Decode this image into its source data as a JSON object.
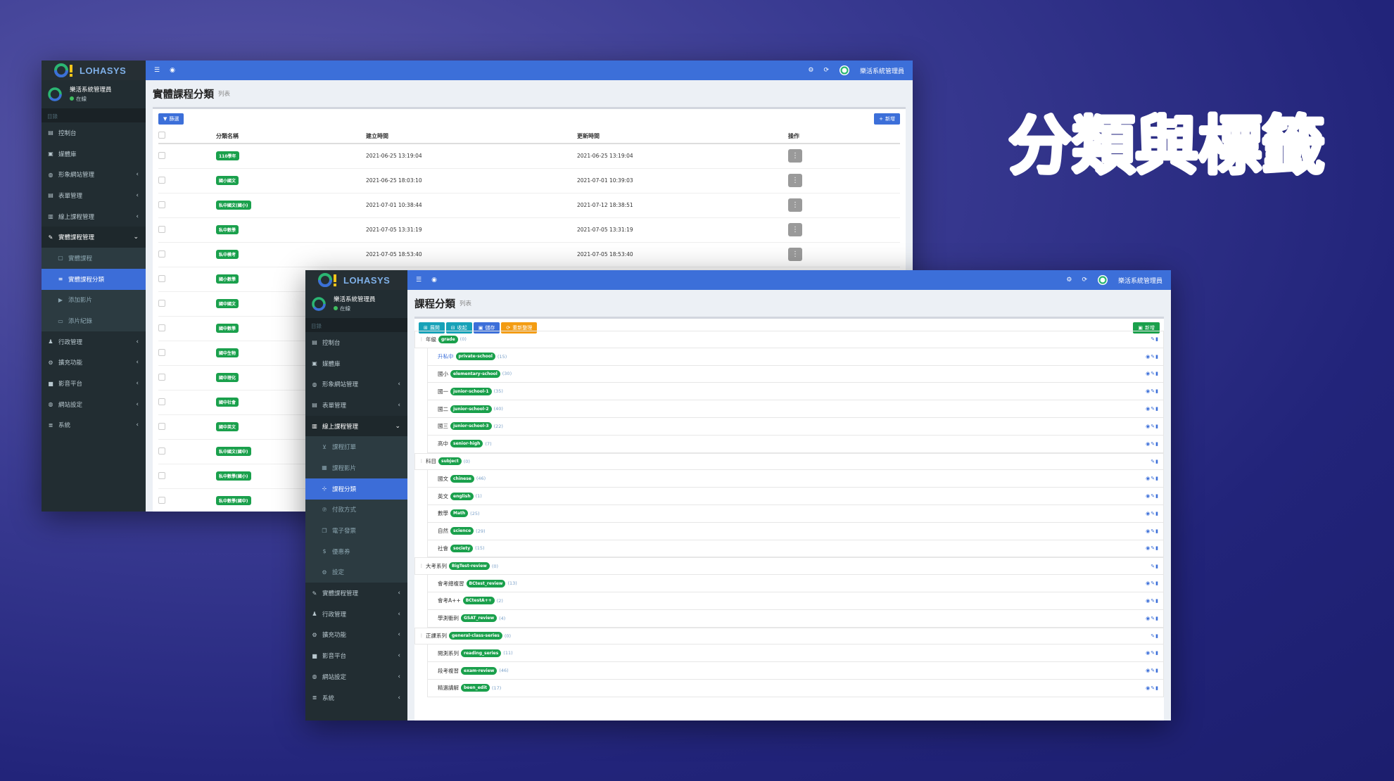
{
  "hero_title": "分類與標籤",
  "brand": "LOHASYS",
  "user": {
    "name": "樂活系統管理員",
    "status": "在線"
  },
  "sidebar_header": "目錄",
  "window1": {
    "menu": [
      {
        "label": "控制台",
        "icon": "chart-icon",
        "chev": ""
      },
      {
        "label": "媒體庫",
        "icon": "image-icon",
        "chev": ""
      },
      {
        "label": "形象網站管理",
        "icon": "globe-icon",
        "chev": "‹"
      },
      {
        "label": "表單管理",
        "icon": "form-icon",
        "chev": "‹"
      },
      {
        "label": "線上課程管理",
        "icon": "bank-icon",
        "chev": "‹"
      },
      {
        "label": "實體課程管理",
        "icon": "edit-icon",
        "chev": "⌄"
      },
      {
        "label": "實體課程",
        "icon": "square-icon",
        "chev": ""
      },
      {
        "label": "實體課程分類",
        "icon": "list-icon",
        "chev": ""
      },
      {
        "label": "添加影片",
        "icon": "video-icon",
        "chev": ""
      },
      {
        "label": "添片紀錄",
        "icon": "monitor-icon",
        "chev": ""
      },
      {
        "label": "行政管理",
        "icon": "user-icon",
        "chev": "‹"
      },
      {
        "label": "擴充功能",
        "icon": "gears-icon",
        "chev": "‹"
      },
      {
        "label": "影音平台",
        "icon": "camera-icon",
        "chev": "‹"
      },
      {
        "label": "網站設定",
        "icon": "globe-icon",
        "chev": "‹"
      },
      {
        "label": "系統",
        "icon": "menu-icon",
        "chev": "‹"
      }
    ],
    "page_title": "實體課程分類",
    "page_subtitle": "列表",
    "filter_btn": "篩選",
    "add_btn": "新增",
    "columns": [
      "分類名稱",
      "建立時間",
      "更新時間",
      "操作"
    ],
    "rows": [
      {
        "tag": "110學年",
        "created": "2021-06-25 13:19:04",
        "updated": "2021-06-25 13:19:04"
      },
      {
        "tag": "國小國文",
        "created": "2021-06-25 18:03:10",
        "updated": "2021-07-01 10:39:03"
      },
      {
        "tag": "私中國文(國小)",
        "created": "2021-07-01 10:38:44",
        "updated": "2021-07-12 18:38:51"
      },
      {
        "tag": "私中數學",
        "created": "2021-07-05 13:31:19",
        "updated": "2021-07-05 13:31:19"
      },
      {
        "tag": "私中模考",
        "created": "2021-07-05 18:53:40",
        "updated": "2021-07-05 18:53:40"
      },
      {
        "tag": "國小數學",
        "created": "",
        "updated": ""
      },
      {
        "tag": "國中國文",
        "created": "",
        "updated": ""
      },
      {
        "tag": "國中數學",
        "created": "",
        "updated": ""
      },
      {
        "tag": "國中生物",
        "created": "",
        "updated": ""
      },
      {
        "tag": "國中理化",
        "created": "",
        "updated": ""
      },
      {
        "tag": "國中社會",
        "created": "",
        "updated": ""
      },
      {
        "tag": "國中英文",
        "created": "",
        "updated": ""
      },
      {
        "tag": "私中國文(國中)",
        "created": "",
        "updated": ""
      },
      {
        "tag": "私中數學(國小)",
        "created": "",
        "updated": ""
      },
      {
        "tag": "私中數學(國中)",
        "created": "",
        "updated": ""
      }
    ]
  },
  "window2": {
    "menu": [
      {
        "label": "控制台",
        "icon": "chart-icon",
        "chev": ""
      },
      {
        "label": "媒體庫",
        "icon": "image-icon",
        "chev": ""
      },
      {
        "label": "形象網站管理",
        "icon": "globe-icon",
        "chev": "‹"
      },
      {
        "label": "表單管理",
        "icon": "form-icon",
        "chev": "‹"
      },
      {
        "label": "線上課程管理",
        "icon": "bank-icon",
        "chev": "⌄"
      },
      {
        "label": "課程訂單",
        "icon": "cart-icon",
        "chev": ""
      },
      {
        "label": "課程影片",
        "icon": "film-icon",
        "chev": ""
      },
      {
        "label": "課程分類",
        "icon": "sitemap-icon",
        "chev": ""
      },
      {
        "label": "付款方式",
        "icon": "paypal-icon",
        "chev": ""
      },
      {
        "label": "電子發票",
        "icon": "copy-icon",
        "chev": ""
      },
      {
        "label": "優惠券",
        "icon": "dollar-icon",
        "chev": ""
      },
      {
        "label": "設定",
        "icon": "gears-icon",
        "chev": ""
      },
      {
        "label": "實體課程管理",
        "icon": "edit-icon",
        "chev": "‹"
      },
      {
        "label": "行政管理",
        "icon": "user-icon",
        "chev": "‹"
      },
      {
        "label": "擴充功能",
        "icon": "gears-icon",
        "chev": "‹"
      },
      {
        "label": "影音平台",
        "icon": "camera-icon",
        "chev": "‹"
      },
      {
        "label": "網站設定",
        "icon": "globe-icon",
        "chev": "‹"
      },
      {
        "label": "系統",
        "icon": "menu-icon",
        "chev": "‹"
      }
    ],
    "page_title": "課程分類",
    "page_subtitle": "列表",
    "toolbar": {
      "expand": "展開",
      "collapse": "收起",
      "save": "儲存",
      "refresh": "重新整理",
      "add": "新增"
    },
    "tree": [
      {
        "cat": true,
        "label": "年級",
        "slug": "grade",
        "count": "(0)"
      },
      {
        "cat": false,
        "label": "升私中",
        "slug": "private-school",
        "count": "(15)",
        "link": true
      },
      {
        "cat": false,
        "label": "國小",
        "slug": "elementary-school",
        "count": "(30)"
      },
      {
        "cat": false,
        "label": "國一",
        "slug": "junior-school-1",
        "count": "(35)"
      },
      {
        "cat": false,
        "label": "國二",
        "slug": "junior-school-2",
        "count": "(40)"
      },
      {
        "cat": false,
        "label": "國三",
        "slug": "junior-school-3",
        "count": "(22)"
      },
      {
        "cat": false,
        "label": "高中",
        "slug": "senior-high",
        "count": "(7)"
      },
      {
        "cat": true,
        "label": "科目",
        "slug": "subject",
        "count": "(0)"
      },
      {
        "cat": false,
        "label": "國文",
        "slug": "chinese",
        "count": "(46)"
      },
      {
        "cat": false,
        "label": "英文",
        "slug": "english",
        "count": "(1)"
      },
      {
        "cat": false,
        "label": "數學",
        "slug": "Math",
        "count": "(25)"
      },
      {
        "cat": false,
        "label": "自然",
        "slug": "science",
        "count": "(29)"
      },
      {
        "cat": false,
        "label": "社會",
        "slug": "society",
        "count": "(15)"
      },
      {
        "cat": true,
        "label": "大考系列",
        "slug": "BigTest-review",
        "count": "(0)"
      },
      {
        "cat": false,
        "label": "會考總複習",
        "slug": "BCtest_review",
        "count": "(13)"
      },
      {
        "cat": false,
        "label": "會考A++",
        "slug": "BCtestA++",
        "count": "(2)"
      },
      {
        "cat": false,
        "label": "學測衝刺",
        "slug": "GSAT_review",
        "count": "(4)"
      },
      {
        "cat": true,
        "label": "正課系列",
        "slug": "general-class-series",
        "count": "(0)"
      },
      {
        "cat": false,
        "label": "閱測系列",
        "slug": "reading_series",
        "count": "(11)"
      },
      {
        "cat": false,
        "label": "段考複習",
        "slug": "exam-review",
        "count": "(46)"
      },
      {
        "cat": false,
        "label": "精選講解",
        "slug": "been_edit",
        "count": "(17)"
      }
    ]
  }
}
